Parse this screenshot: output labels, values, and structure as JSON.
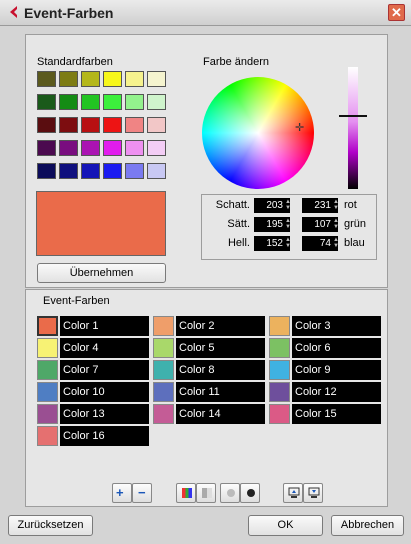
{
  "window": {
    "title": "Event-Farben",
    "close_glyph": "✕"
  },
  "standard": {
    "label": "Standardfarben",
    "colors": [
      [
        "#5b5a1e",
        "#7d7c13",
        "#b4b71a",
        "#f7f71b",
        "#f6f28e",
        "#f5f4cf"
      ],
      [
        "#1a5a1a",
        "#148c14",
        "#22c422",
        "#3cef3c",
        "#93f28d",
        "#cff4cc"
      ],
      [
        "#5a0d10",
        "#7d0d10",
        "#b81012",
        "#ed1414",
        "#f08484",
        "#f2c7c7"
      ],
      [
        "#4b0a4f",
        "#790d7f",
        "#aa13b2",
        "#e11ced",
        "#ee90f0",
        "#f3cdf5"
      ],
      [
        "#0c0c5a",
        "#10107e",
        "#1414b7",
        "#1b1bf0",
        "#7a7af0",
        "#c8c8f3"
      ]
    ],
    "preview_color": "#ea6b4a",
    "apply_button": "Übernehmen"
  },
  "change": {
    "label": "Farbe ändern",
    "fields_left": [
      {
        "label": "Schatt.",
        "value": "203"
      },
      {
        "label": "Sätt.",
        "value": "195"
      },
      {
        "label": "Hell.",
        "value": "152"
      }
    ],
    "fields_right": [
      {
        "label": "rot",
        "value": "231"
      },
      {
        "label": "grün",
        "value": "107"
      },
      {
        "label": "blau",
        "value": "74"
      }
    ],
    "brightness_level": 0.4
  },
  "event": {
    "label": "Event-Farben",
    "selected_index": 0,
    "items": [
      {
        "name": "Color 1",
        "color": "#ea6b4a"
      },
      {
        "name": "Color 2",
        "color": "#ef9e6a"
      },
      {
        "name": "Color 3",
        "color": "#ecb25e"
      },
      {
        "name": "Color 4",
        "color": "#f7f274"
      },
      {
        "name": "Color 5",
        "color": "#a9d86a"
      },
      {
        "name": "Color 6",
        "color": "#7cc163"
      },
      {
        "name": "Color 7",
        "color": "#4fa868"
      },
      {
        "name": "Color 8",
        "color": "#3fb1ad"
      },
      {
        "name": "Color 9",
        "color": "#3fb2e2"
      },
      {
        "name": "Color 10",
        "color": "#4f7ec3"
      },
      {
        "name": "Color 11",
        "color": "#5d6fbd"
      },
      {
        "name": "Color 12",
        "color": "#6e4f9c"
      },
      {
        "name": "Color 13",
        "color": "#9a4f92"
      },
      {
        "name": "Color 14",
        "color": "#c45c96"
      },
      {
        "name": "Color 15",
        "color": "#db5a86"
      },
      {
        "name": "Color 16",
        "color": "#e57070"
      }
    ]
  },
  "footer": {
    "reset": "Zurücksetzen",
    "ok": "OK",
    "cancel": "Abbrechen"
  }
}
